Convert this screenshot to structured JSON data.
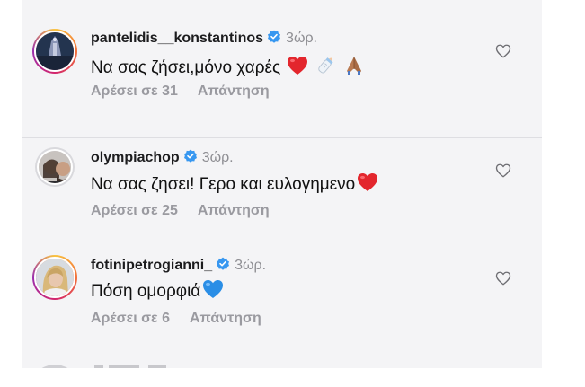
{
  "comments": [
    {
      "username": "pantelidis__konstantinos",
      "time": "3ώρ.",
      "text": "Να σας ζήσει,μόνο χαρές",
      "emoji_icons": [
        "red-heart-icon",
        "baby-bottle-icon",
        "folded-hands-icon"
      ],
      "likes": "Αρέσει σε 31",
      "reply": "Απάντηση",
      "avatar": "ring-avatar"
    },
    {
      "username": "olympiachop",
      "time": "3ώρ.",
      "text": "Να σας ζησει! Γερο και ευλογημενο",
      "emoji_icons": [
        "red-heart-icon"
      ],
      "likes": "Αρέσει σε 25",
      "reply": "Απάντηση",
      "avatar": "plain-avatar"
    },
    {
      "username": "fotinipetrogianni_",
      "time": "3ώρ.",
      "text": "Πόση ομορφιά",
      "emoji_icons": [
        "blue-heart-icon"
      ],
      "likes": "Αρέσει σε 6",
      "reply": "Απάντηση",
      "avatar": "ring-avatar"
    }
  ],
  "colors": {
    "verified": "#3797f0",
    "muted": "#9a9aa0",
    "panel": "#f4f4f6"
  }
}
